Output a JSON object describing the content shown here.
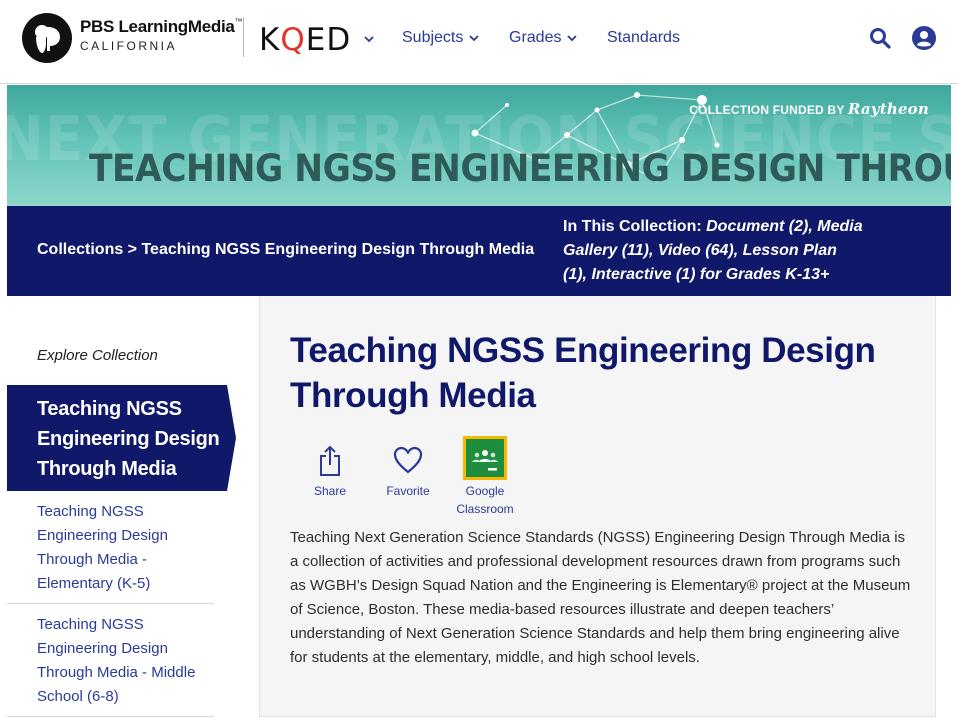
{
  "header": {
    "brand_main": "PBS LearningMedia",
    "brand_tm": "™",
    "brand_sub": "CALIFORNIA",
    "station_k": "K",
    "station_q": "Q",
    "station_ed": "ED",
    "nav": [
      {
        "label": "Subjects"
      },
      {
        "label": "Grades"
      },
      {
        "label": "Standards"
      }
    ],
    "icons": [
      "pbs-logo-icon",
      "chevron-down-icon",
      "search-icon",
      "user-icon"
    ],
    "colors": {
      "nav": "#2b3a98",
      "navy": "#10186a",
      "kqed_q": "#e4322b"
    }
  },
  "banner": {
    "bg_text": "NEXT GENERATION SCIENCE STANDARDS",
    "title": "TEACHING NGSS ENGINEERING DESIGN THROUGH MEDIA",
    "funded_prefix": "COLLECTION FUNDED BY",
    "funded_brand": "Raytheon"
  },
  "collection_bar": {
    "breadcrumb": "Collections > Teaching NGSS Engineering Design Through Media",
    "in_collection_label": "In This Collection:",
    "in_collection_value": "Document (2), Media Gallery (11), Video (64), Lesson Plan (1), Interactive (1) for Grades K-13+"
  },
  "sidebar": {
    "explore_label": "Explore Collection",
    "active_item": "Teaching NGSS Engineering Design Through Media",
    "links": [
      {
        "label": "Teaching NGSS Engineering Design Through Media - Elementary (K-5)"
      },
      {
        "label": "Teaching NGSS Engineering Design Through Media - Middle School (6-8)"
      }
    ]
  },
  "main": {
    "title": "Teaching NGSS Engineering Design Through Media",
    "actions": {
      "share": "Share",
      "favorite": "Favorite",
      "google_classroom": "Google Classroom"
    },
    "description": "Teaching Next Generation Science Standards (NGSS) Engineering Design Through Media is a collection of activities and professional development resources drawn from programs such as WGBH’s Design Squad Nation and the Engineering is Elementary® project at the Museum of Science, Boston. These media-based resources illustrate and deepen teachers’ understanding of Next Generation Science Standards and help them bring engineering alive for students at the elementary, middle, and high school levels."
  }
}
